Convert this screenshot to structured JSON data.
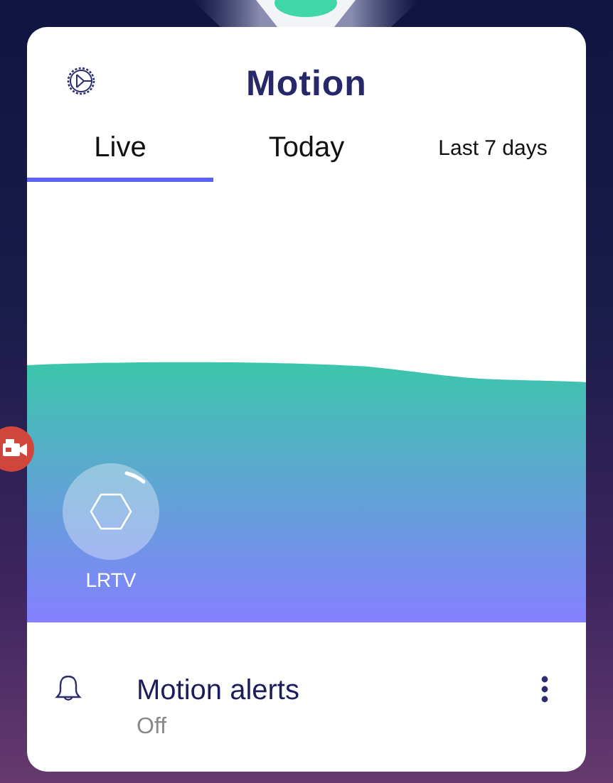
{
  "title": "Motion",
  "tabs": [
    {
      "label": "Live",
      "selected": true
    },
    {
      "label": "Today",
      "selected": false
    },
    {
      "label": "Last 7 days",
      "selected": false
    }
  ],
  "devices": [
    {
      "label": "LRTV"
    }
  ],
  "alert": {
    "title": "Motion alerts",
    "status": "Off"
  }
}
